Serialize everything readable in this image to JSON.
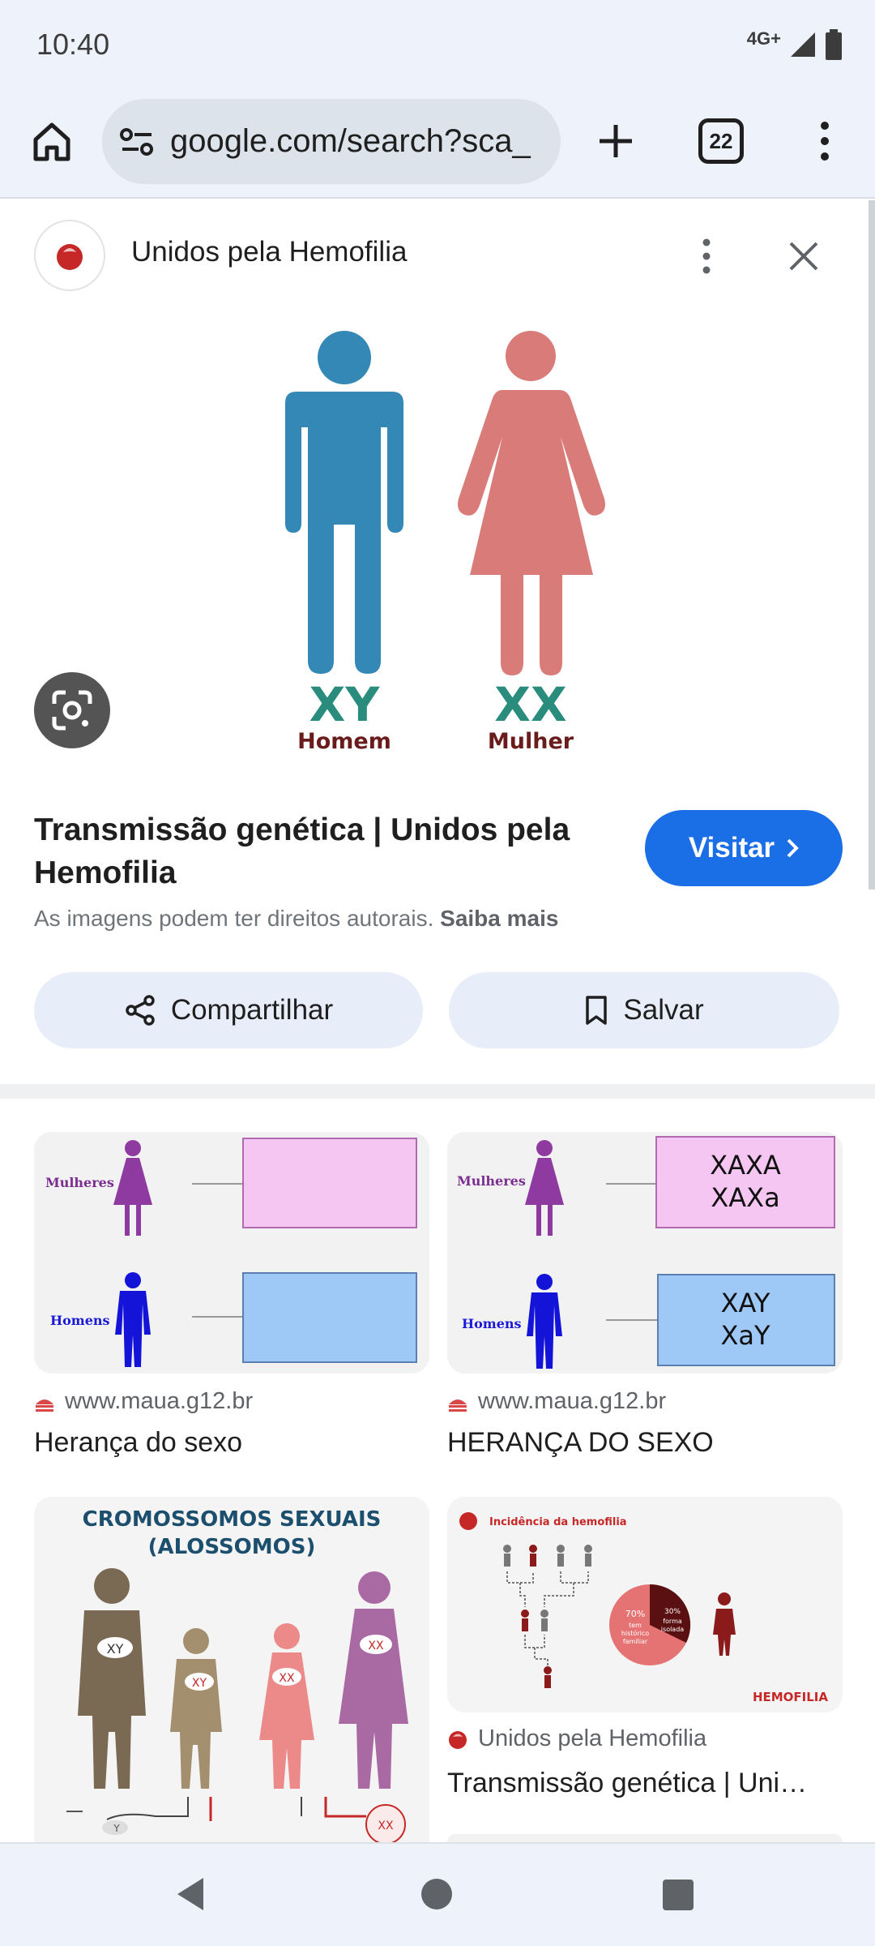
{
  "status": {
    "time": "10:40",
    "network": "4G+",
    "icons": [
      "signal-icon",
      "battery-icon"
    ]
  },
  "browser": {
    "url": "google.com/search?sca_",
    "tab_count": "22",
    "icons": [
      "home-icon",
      "site-info-icon",
      "plus-icon",
      "more-vert-icon"
    ]
  },
  "viewer": {
    "site_name": "Unidos pela Hemofilia",
    "image": {
      "left_chromosomes": "XY",
      "left_label": "Homem",
      "right_chromosomes": "XX",
      "right_label": "Mulher",
      "colors": {
        "man": "#3388b5",
        "woman": "#d97b78",
        "chromo": "#2a8c7c",
        "label": "#6a1b1b"
      }
    },
    "title": "Transmissão genética | Unidos pela Hemofilia",
    "visit_label": "Visitar",
    "copyright_text": "As imagens podem ter direitos autorais.",
    "copyright_link": "Saiba mais",
    "share_label": "Compartilhar",
    "save_label": "Salvar"
  },
  "results": [
    {
      "source": "www.maua.g12.br",
      "title": "Herança do sexo",
      "image": {
        "women_label": "Mulheres",
        "men_label": "Homens"
      }
    },
    {
      "source": "www.maua.g12.br",
      "title": "HERANÇA DO SEXO",
      "image": {
        "women_label": "Mulheres",
        "men_label": "Homens",
        "women_g1": "XAXA",
        "women_g2": "XAXa",
        "men_g1": "XAY",
        "men_g2": "XaY"
      }
    },
    {
      "source": "",
      "title": "",
      "image": {
        "heading1": "CROMOSSOMOS SEXUAIS",
        "heading2": "(ALOSSOMOS)"
      }
    },
    {
      "source": "Unidos pela Hemofilia",
      "title": "Transmissão genética | Uni…",
      "image": {
        "heading": "Incidência da hemofilia",
        "pct1": "70%",
        "pct1_text1": "tem",
        "pct1_text2": "histórico",
        "pct1_text3": "familiar",
        "pct2": "30%",
        "pct2_text1": "forma",
        "pct2_text2": "isolada",
        "brand": "HEMOFILIA"
      }
    }
  ],
  "accent": {
    "link_blue": "#1a6ee6",
    "chip_bg": "#e8eef9"
  }
}
